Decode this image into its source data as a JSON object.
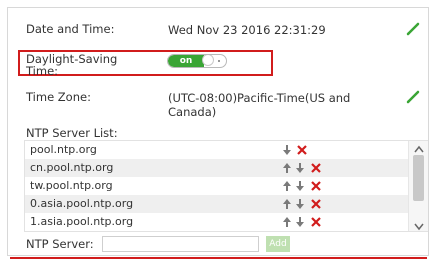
{
  "settings": {
    "date_time_label": "Date and Time:",
    "date_time_value": "Wed Nov 23 2016 22:31:29",
    "dst_label_line1": "Daylight-Saving",
    "dst_label_line2": "Time:",
    "dst_toggle_on_text": "on",
    "dst_enabled": true,
    "time_zone_label": "Time Zone:",
    "time_zone_line1": "(UTC-08:00)Pacific-Time(US and",
    "time_zone_line2": "Canada)"
  },
  "ntp": {
    "list_label": "NTP Server List:",
    "servers": [
      "pool.ntp.org",
      "cn.pool.ntp.org",
      "tw.pool.ntp.org",
      "0.asia.pool.ntp.org",
      "1.asia.pool.ntp.org"
    ],
    "server_label": "NTP Server:",
    "server_input_value": "",
    "add_label": "Add"
  },
  "icons": {
    "edit": "pencil-icon",
    "move_up": "arrow-up-icon",
    "move_down": "arrow-down-icon",
    "delete": "delete-x-icon"
  },
  "colors": {
    "accent_green": "#3aa535",
    "delete_red": "#d11c1c",
    "arrow_gray": "#7a7a7a",
    "highlight_red": "#d11c1c"
  }
}
